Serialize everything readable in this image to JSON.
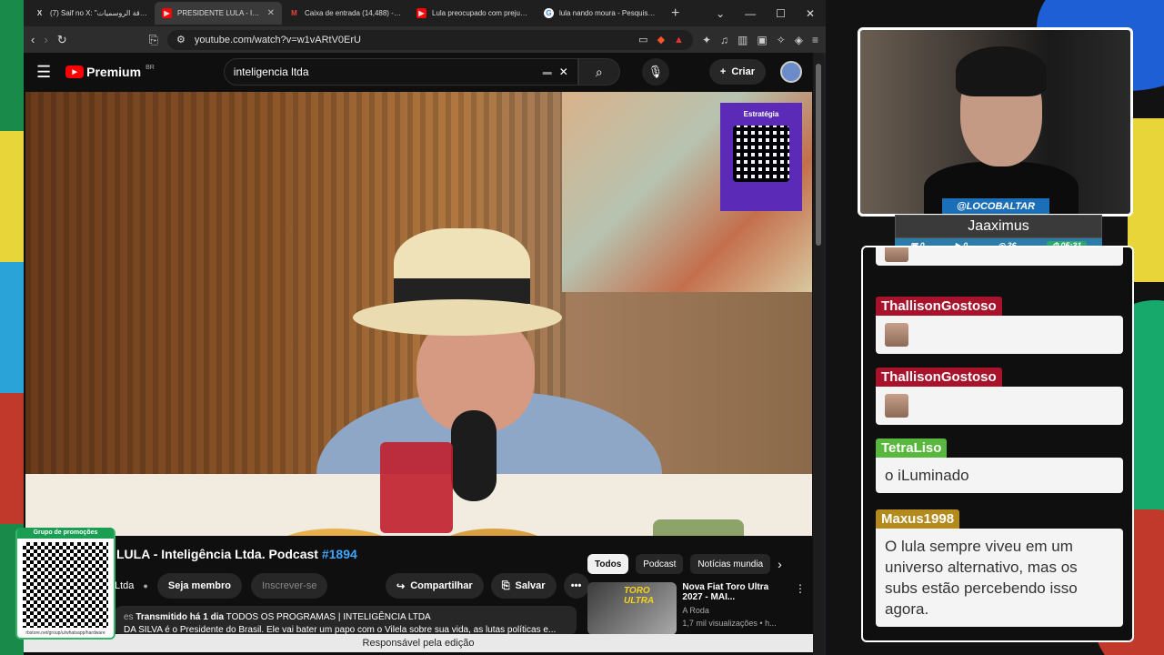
{
  "browser": {
    "tabs": [
      {
        "title": "(7) Saif no X: \"بطاقة الروسميات ...",
        "active": false,
        "favicon": "x-icon",
        "favicon_color": "#ffffff"
      },
      {
        "title": "PRESIDENTE LULA - Inte...",
        "active": true,
        "favicon": "youtube-icon",
        "favicon_color": "#ff0000"
      },
      {
        "title": "Caixa de entrada (14,488) - theb...",
        "active": false,
        "favicon": "gmail-icon",
        "favicon_color": "#ea4335"
      },
      {
        "title": "Lula preocupado com prejuízo e...",
        "active": false,
        "favicon": "youtube-icon",
        "favicon_color": "#ff0000"
      },
      {
        "title": "lula nando moura - Pesquisa Go...",
        "active": false,
        "favicon": "google-icon",
        "favicon_color": "#4285f4"
      }
    ],
    "url": "youtube.com/watch?v=w1vARtV0ErU"
  },
  "youtube": {
    "logo_text": "Premium",
    "logo_region": "BR",
    "search_query": "inteligencia ltda",
    "create_label": "Criar",
    "sponsor_brand": "Estratégia",
    "video_title_main": "LULA - Inteligência Ltda. Podcast",
    "video_title_tag": "#1894",
    "channel_name": "Ltda",
    "member_label": "Seja membro",
    "subscribe_label": "Inscrever-se",
    "share_label": "Compartilhar",
    "save_label": "Salvar",
    "desc_prefix": "es",
    "desc_streamed": "Transmitido há 1 dia",
    "desc_category": "TODOS OS PROGRAMAS | INTELIGÊNCIA LTDA",
    "desc_line2": "DA SILVA é o Presidente do Brasil. Ele vai bater um papo com o Vilela sobre sua vida, as lutas políticas e...",
    "chips": [
      "Todos",
      "Podcast",
      "Notícias mundia"
    ],
    "rec": {
      "thumb_text": "TORO ULTRA",
      "title": "Nova Fiat Toro Ultra 2027 - MAI...",
      "channel": "A Roda",
      "views": "1,7 mil visualizações • h..."
    },
    "footer": "Responsável pela edição"
  },
  "overlay": {
    "qr_label": "Grupo de promoções",
    "qr_url": "rbstore.net/group/u/whatsapp/hardware"
  },
  "stream": {
    "handle": "@LOCOBALTAR",
    "name": "Jaaximus",
    "stats": {
      "a": "0",
      "b": "0",
      "c": "36",
      "time": "05:31"
    }
  },
  "chat": [
    {
      "user": "ThallisonGostoso",
      "kind": "emote",
      "color": "#a8122b"
    },
    {
      "user": "ThallisonGostoso",
      "kind": "emote",
      "color": "#a8122b"
    },
    {
      "user": "TetraLiso",
      "kind": "text",
      "text": "o iLuminado",
      "color": "#58b83d"
    },
    {
      "user": "Maxus1998",
      "kind": "text",
      "text": "O lula sempre viveu em um universo alternativo, mas os subs estão percebendo isso agora.",
      "color": "#b58a1c"
    }
  ]
}
